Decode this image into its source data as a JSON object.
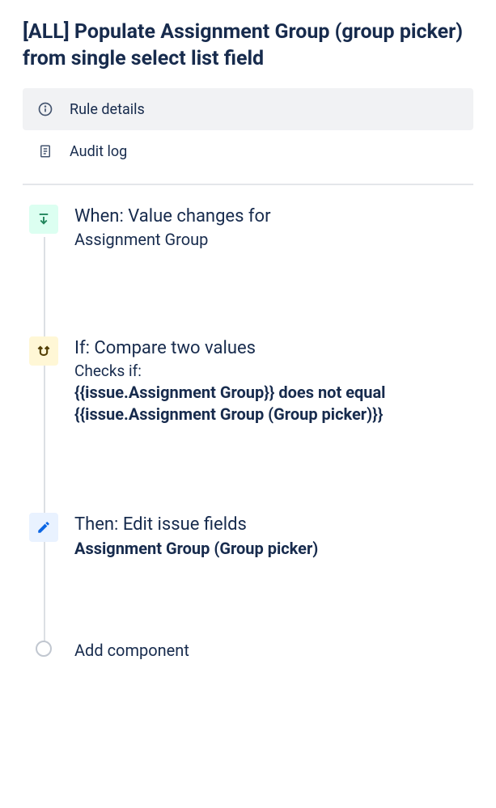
{
  "rule": {
    "title": "[ALL] Populate Assignment Group (group picker) from single select list field"
  },
  "menu": {
    "details": "Rule details",
    "audit_log": "Audit log"
  },
  "steps": {
    "when": {
      "title": "When: Value changes for",
      "field": "Assignment Group"
    },
    "if": {
      "title": "If: Compare two values",
      "subtitle": "Checks if:",
      "detail": "{{issue.Assignment Group}} does not equal {{issue.Assignment Group (Group picker)}}"
    },
    "then": {
      "title": "Then: Edit issue fields",
      "detail": "Assignment Group (Group picker)"
    },
    "add": {
      "label": "Add component"
    }
  }
}
